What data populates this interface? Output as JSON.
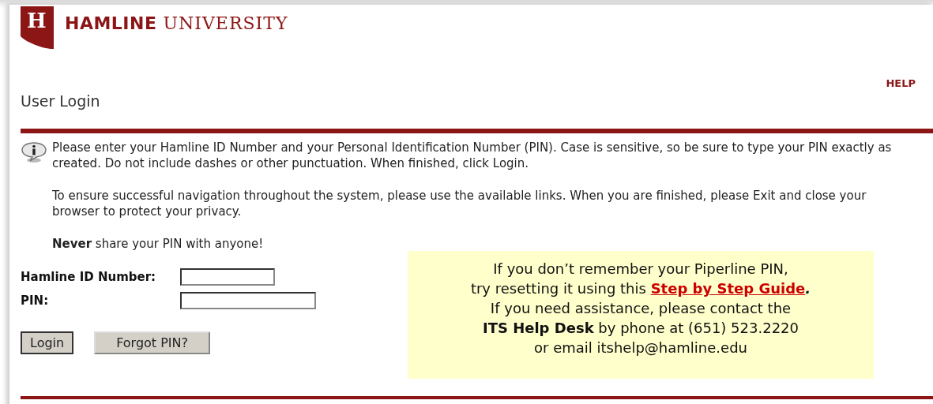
{
  "header": {
    "logo_letter": "H",
    "name_bold": "HAMLINE",
    "name_serif": "UNIVERSITY",
    "help_link": "HELP"
  },
  "title": "User Login",
  "info_paragraphs": [
    "Please enter your Hamline ID Number and your Personal Identification Number (PIN). Case is sensitive, so be sure to type your PIN exactly as created. Do not include dashes or other punctuation. When finished, click Login.",
    "To ensure successful navigation throughout the system, please use the available links. When you are finished, please Exit and close your browser to protect your privacy.",
    "**Never** share your PIN with anyone!"
  ],
  "form": {
    "fields": [
      {
        "label": "Hamline ID Number:",
        "kind": "text"
      },
      {
        "label": "PIN:",
        "kind": "password"
      }
    ],
    "buttons": [
      "Login",
      "Forgot PIN?"
    ]
  },
  "notice": {
    "line_1": "If you don’t remember your Piperline PIN,",
    "line_2_before": "try resetting it using this",
    "link": "Step by Step Guide",
    "line_2_after": ".",
    "line_3": "If you need assistance, please contact the",
    "line_4": "**ITS Help Desk** by phone at (651) 523.2220",
    "line_5": "or email itshelp@hamline.edu"
  }
}
